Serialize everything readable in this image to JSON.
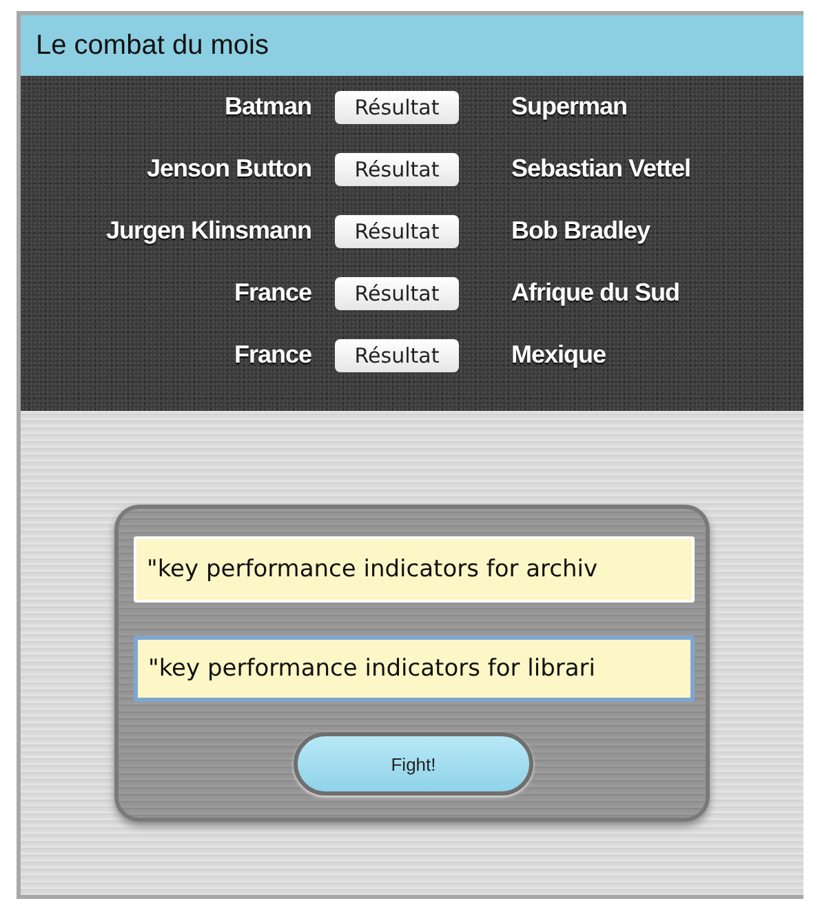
{
  "header": {
    "title": "Le combat du mois"
  },
  "matches": [
    {
      "left": "Batman",
      "button": "Résultat",
      "right": "Superman"
    },
    {
      "left": "Jenson Button",
      "button": "Résultat",
      "right": "Sebastian Vettel"
    },
    {
      "left": "Jurgen Klinsmann",
      "button": "Résultat",
      "right": "Bob Bradley"
    },
    {
      "left": "France",
      "button": "Résultat",
      "right": "Afrique du Sud"
    },
    {
      "left": "France",
      "button": "Résultat",
      "right": "Mexique"
    }
  ],
  "form": {
    "fields": [
      {
        "value": "\"key performance indicators for archiv",
        "focused": false
      },
      {
        "value": "\"key performance indicators for librari",
        "focused": true
      }
    ],
    "button": "Fight!"
  }
}
